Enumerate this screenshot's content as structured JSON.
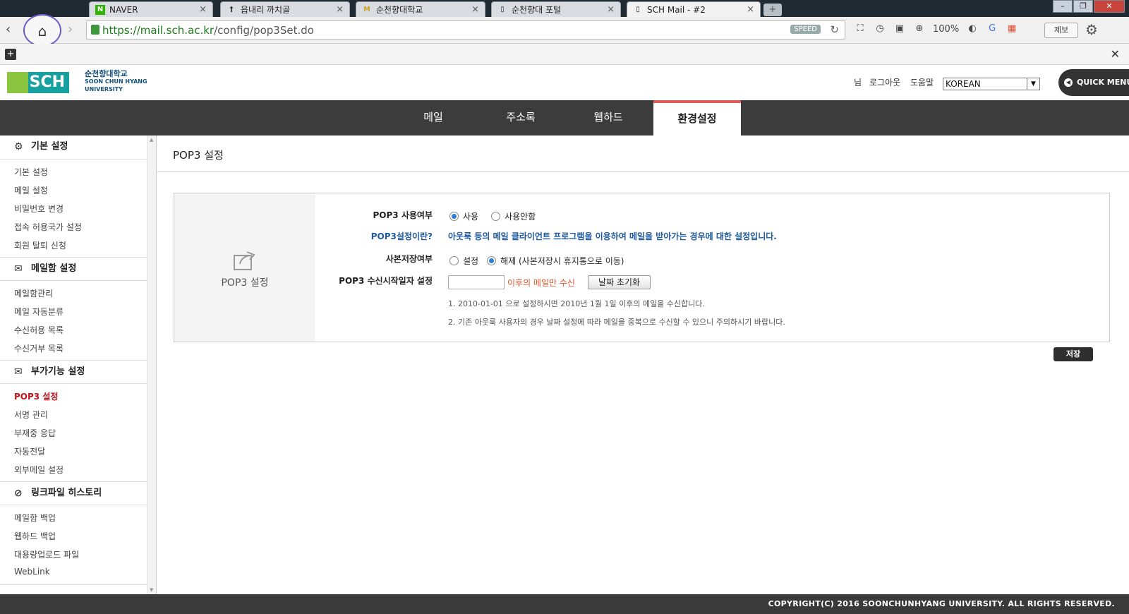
{
  "browser": {
    "tabs": [
      {
        "label": "NAVER",
        "icon": "N"
      },
      {
        "label": "읍내리 까치골",
        "icon": "†"
      },
      {
        "label": "순천향대학교",
        "icon": "M"
      },
      {
        "label": "순천향대 포털",
        "icon": "▯"
      },
      {
        "label": "SCH Mail - #2",
        "icon": "▯"
      }
    ],
    "url_host": "https://mail.sch.ac.kr",
    "url_path": "/config/pop3Set.do",
    "speed_badge": "SPEED",
    "zoom": "100%",
    "report_label": "제보"
  },
  "header": {
    "logo_mark": "SCH",
    "logo_ko": "순천향대학교",
    "logo_en1": "SOON CHUN HYANG",
    "logo_en2": "UNIVERSITY",
    "user_suffix": "님",
    "logout": "로그아웃",
    "help": "도움말",
    "language": "KOREAN",
    "quick_menu": "QUICK MENU"
  },
  "mainnav": [
    "메일",
    "주소록",
    "웹하드",
    "환경설정"
  ],
  "sidebar": {
    "groups": [
      {
        "title": "기본 설정",
        "items": [
          "기본 설정",
          "메일 설정",
          "비밀번호 변경",
          "접속 허용국가 설정",
          "회원 탈퇴 신청"
        ]
      },
      {
        "title": "메일함 설정",
        "items": [
          "메일함관리",
          "메일 자동분류",
          "수신허용 목록",
          "수신거부 목록"
        ]
      },
      {
        "title": "부가기능 설정",
        "items": [
          "POP3 설정",
          "서명 관리",
          "부재중 응답",
          "자동전달",
          "외부메일 설정"
        ]
      },
      {
        "title": "링크파일 히스토리",
        "items": [
          "메일함 백업",
          "웹하드 백업",
          "대용량업로드 파일",
          "WebLink"
        ]
      }
    ]
  },
  "content": {
    "title": "POP3 설정",
    "panel_label": "POP3 설정",
    "rows": {
      "use_label": "POP3 사용여부",
      "use_on": "사용",
      "use_off": "사용안함",
      "what_label": "POP3설정이란?",
      "what_desc": "아웃룩 등의 메일 클라이언트 프로그램을 이용하여 메일을 받아가는 경우에 대한 설정입니다.",
      "copy_label": "사본저장여부",
      "copy_on": "설정",
      "copy_off": "해제 (사본저장시 휴지통으로 이동)",
      "date_label": "POP3 수신시작일자 설정",
      "date_value": "",
      "date_suffix": "이후의 메일만 수신",
      "date_reset": "날짜 초기화",
      "note1": "1. 2010-01-01 으로 설정하시면 2010년 1월 1일 이후의 메일을 수신합니다.",
      "note2": "2. 기존 아웃룩 사용자의 경우 날짜 설정에 따라 메일을 중복으로 수신할 수 있으니 주의하시기 바랍니다."
    },
    "save": "저장"
  },
  "footer": "COPYRIGHT(C) 2016 SOONCHUNHYANG UNIVERSITY. ALL RIGHTS RESERVED."
}
